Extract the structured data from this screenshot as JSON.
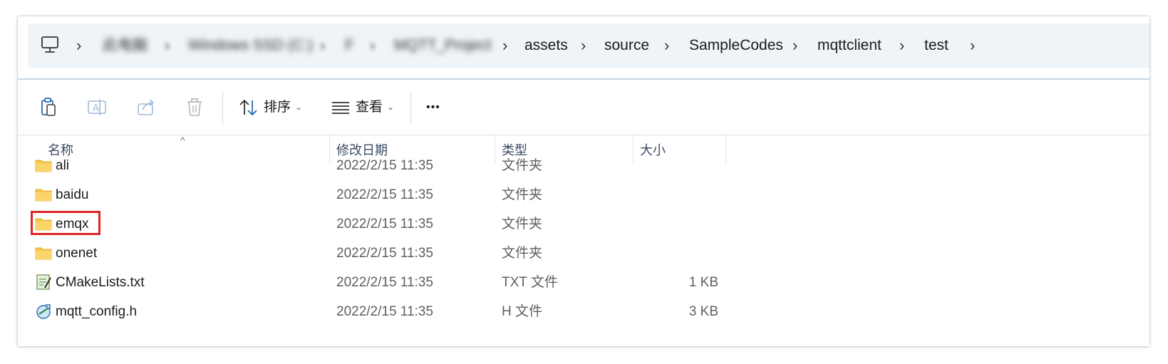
{
  "breadcrumb": {
    "items": [
      "此电脑",
      "Windows SSD (C:)",
      "F",
      "MQTT_Project",
      "assets",
      "source",
      "SampleCodes",
      "mqttclient",
      "test"
    ]
  },
  "toolbar": {
    "sort_label": "排序",
    "view_label": "查看",
    "more_label": "•••"
  },
  "columns": {
    "name": "名称",
    "date": "修改日期",
    "type": "类型",
    "size": "大小"
  },
  "files": [
    {
      "name": "ali",
      "date": "2022/2/15 11:35",
      "type": "文件夹",
      "size": "",
      "icon": "folder-icon"
    },
    {
      "name": "baidu",
      "date": "2022/2/15 11:35",
      "type": "文件夹",
      "size": "",
      "icon": "folder-icon"
    },
    {
      "name": "emqx",
      "date": "2022/2/15 11:35",
      "type": "文件夹",
      "size": "",
      "icon": "folder-icon",
      "highlighted": true
    },
    {
      "name": "onenet",
      "date": "2022/2/15 11:35",
      "type": "文件夹",
      "size": "",
      "icon": "folder-icon"
    },
    {
      "name": "CMakeLists.txt",
      "date": "2022/2/15 11:35",
      "type": "TXT 文件",
      "size": "1 KB",
      "icon": "notepad-file-icon"
    },
    {
      "name": "mqtt_config.h",
      "date": "2022/2/15 11:35",
      "type": "H 文件",
      "size": "3 KB",
      "icon": "header-file-icon"
    }
  ],
  "colors": {
    "highlight": "#dc2626",
    "folder": "#f6c54a",
    "address_bg": "#eff4f9"
  }
}
